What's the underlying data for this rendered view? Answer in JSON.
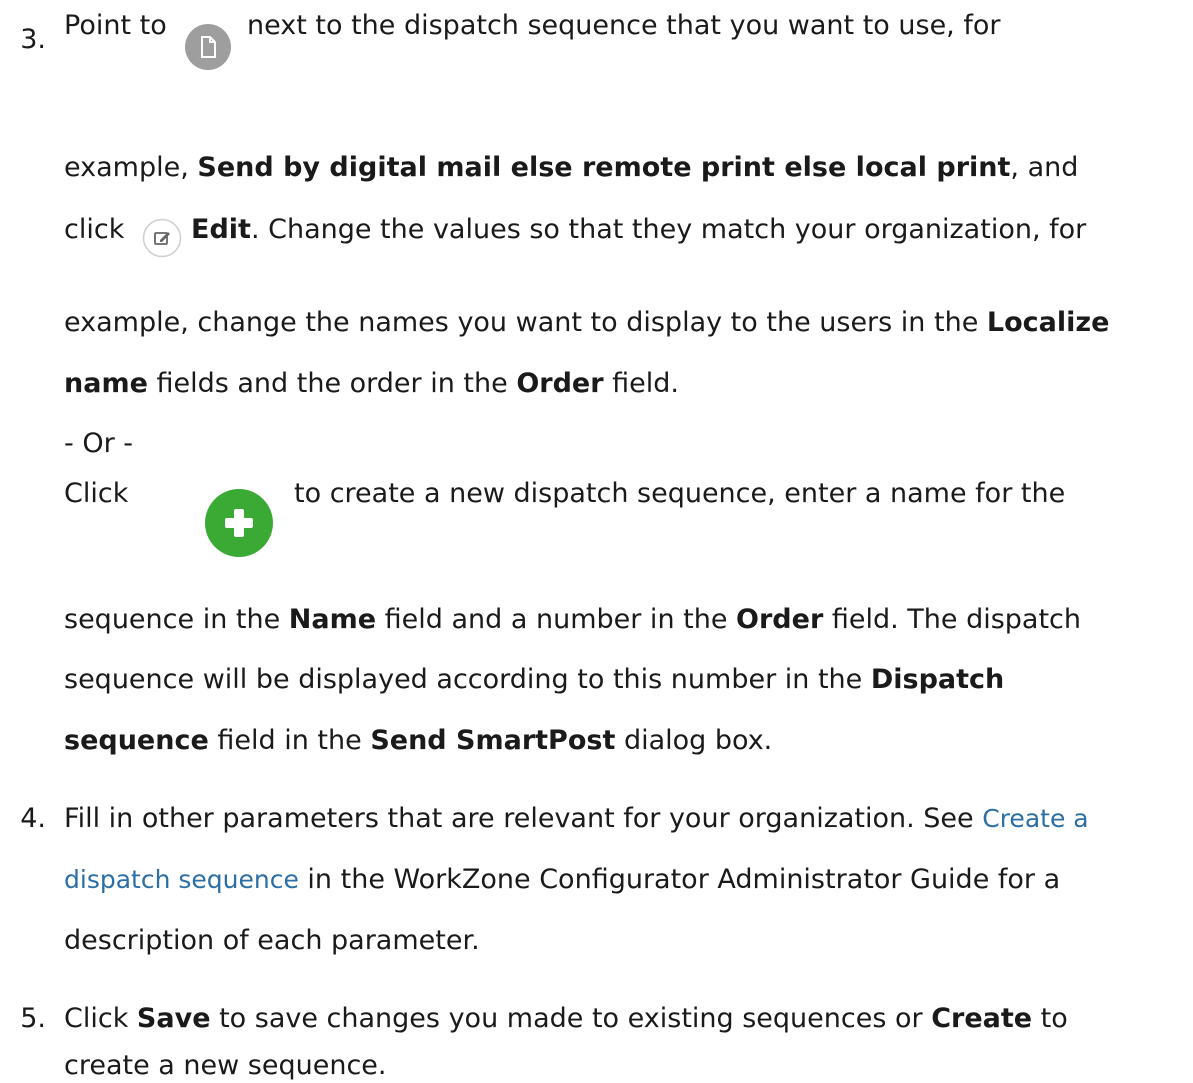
{
  "step3": {
    "number": "3.",
    "l1_a": "Point to",
    "doc_icon": "document-icon",
    "l1_b": "next to the dispatch sequence that you want to use, for",
    "l2_a": "example, ",
    "l2_bold": "Send by digital mail else remote print else local print",
    "l2_b": ", and",
    "l3_a": "click",
    "edit_icon": "edit-icon",
    "l3_bold": "Edit",
    "l3_b": ". Change the values so that they match your organization, for",
    "l4_a": "example, change the names you want to display to the users in the ",
    "l4_bold": "Localize",
    "l5_bold1": "name",
    "l5_a": " fields and the order in the ",
    "l5_bold2": "Order",
    "l5_b": " field.",
    "or": "- Or -",
    "l7_a": "Click",
    "add_icon": "plus-icon",
    "l7_b": "to create a new dispatch sequence, enter a name for the",
    "l8_a": "sequence in the ",
    "l8_bold1": "Name",
    "l8_b": " field and a number in the ",
    "l8_bold2": "Order",
    "l8_c": " field. The dispatch",
    "l9_a": "sequence will be displayed according to this number in the ",
    "l9_bold": "Dispatch",
    "l10_bold1": "sequence",
    "l10_a": " field in the ",
    "l10_bold2": "Send SmartPost",
    "l10_b": " dialog box."
  },
  "step4": {
    "number": "4.",
    "l1_a": "Fill in other parameters that are relevant for your organization. See ",
    "l1_link": "Create a",
    "l2_link": "dispatch sequence",
    "l2_a": " in the WorkZone Configurator Administrator Guide for a",
    "l3_a": "description of each parameter."
  },
  "step5": {
    "number": "5.",
    "l1_a": "Click ",
    "l1_bold1": "Save",
    "l1_b": " to save changes you made to existing sequences or ",
    "l1_bold2": "Create",
    "l1_c": " to",
    "l2_a": "create a new sequence."
  },
  "colors": {
    "link": "#2b6fa6",
    "doc_icon_bg": "#9e9e9e",
    "add_icon_bg": "#3aaa35"
  }
}
